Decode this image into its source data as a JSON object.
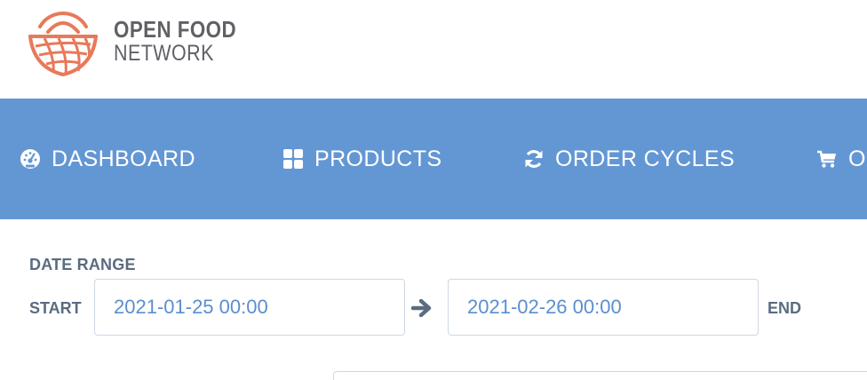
{
  "brand": {
    "line1": "OPEN FOOD",
    "line2": "NETWORK",
    "logo_icon": "basket-logo-icon",
    "color": "#e8795a"
  },
  "nav": {
    "background": "#6397d4",
    "items": [
      {
        "label": "DASHBOARD",
        "icon": "tachometer-icon"
      },
      {
        "label": "PRODUCTS",
        "icon": "grid-icon"
      },
      {
        "label": "ORDER CYCLES",
        "icon": "refresh-icon"
      },
      {
        "label": "O",
        "icon": "cart-icon"
      }
    ]
  },
  "date_range": {
    "label": "DATE RANGE",
    "start_label": "START",
    "start_value": "2021-01-25 00:00",
    "end_value": "2021-02-26 00:00",
    "end_label": "END",
    "arrow_icon": "arrow-right-icon"
  }
}
